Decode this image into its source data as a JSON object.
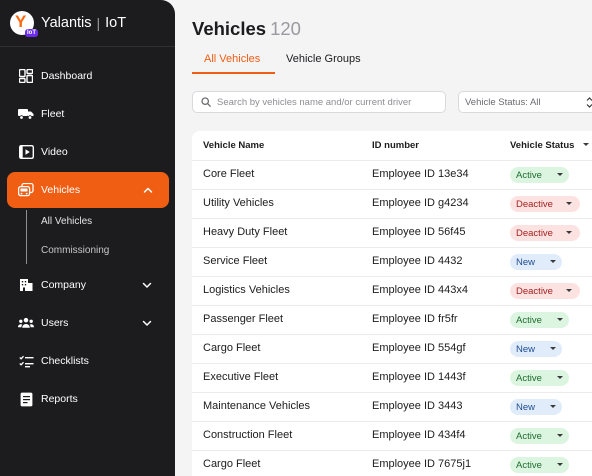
{
  "brand": {
    "name": "Yalantis",
    "separator": "|",
    "product": "IoT",
    "logo_letter": "Y",
    "logo_badge": "IoT"
  },
  "sidebar": {
    "items": [
      {
        "label": "Dashboard",
        "icon": "dashboard-icon"
      },
      {
        "label": "Fleet",
        "icon": "truck-icon"
      },
      {
        "label": "Video",
        "icon": "video-icon"
      },
      {
        "label": "Vehicles",
        "icon": "vehicles-icon",
        "active": true,
        "expanded": true
      },
      {
        "label": "Company",
        "icon": "company-icon"
      },
      {
        "label": "Users",
        "icon": "users-icon"
      },
      {
        "label": "Checklists",
        "icon": "checklist-icon"
      },
      {
        "label": "Reports",
        "icon": "reports-icon"
      }
    ],
    "vehicles_sub": [
      {
        "label": "All Vehicles"
      },
      {
        "label": "Commissioning"
      }
    ]
  },
  "page": {
    "title": "Vehicles",
    "count": "120"
  },
  "tabs": [
    {
      "label": "All Vehicles",
      "active": true
    },
    {
      "label": "Vehicle Groups",
      "active": false
    }
  ],
  "search": {
    "placeholder": "Search by vehicles name and/or current driver",
    "value": ""
  },
  "status_filter": {
    "label": "Vehicle Status: All"
  },
  "table": {
    "columns": [
      "Vehicle Name",
      "ID number",
      "Vehicle Status"
    ],
    "rows": [
      {
        "name": "Core Fleet",
        "id": "Employee ID 13e34",
        "status": "Active"
      },
      {
        "name": "Utility Vehicles",
        "id": "Employee ID g4234",
        "status": "Deactive"
      },
      {
        "name": "Heavy Duty Fleet",
        "id": "Employee ID 56f45",
        "status": "Deactive"
      },
      {
        "name": "Service Fleet",
        "id": "Employee ID 4432",
        "status": "New"
      },
      {
        "name": "Logistics Vehicles",
        "id": "Employee ID 443x4",
        "status": "Deactive"
      },
      {
        "name": "Passenger Fleet",
        "id": "Employee ID fr5fr",
        "status": "Active"
      },
      {
        "name": "Cargo Fleet",
        "id": "Employee ID 554gf",
        "status": "New"
      },
      {
        "name": "Executive Fleet",
        "id": "Employee ID 1443f",
        "status": "Active"
      },
      {
        "name": "Maintenance Vehicles",
        "id": "Employee ID 3443",
        "status": "New"
      },
      {
        "name": "Construction Fleet",
        "id": "Employee ID 434f4",
        "status": "Active"
      },
      {
        "name": "Cargo Fleet",
        "id": "Employee ID 7675j1",
        "status": "Active"
      }
    ]
  },
  "colors": {
    "accent": "#f05e14",
    "sidebar_bg": "#1c1c1e",
    "active_badge": "#dcf5e0",
    "deactive_badge": "#fde2e2",
    "new_badge": "#e1ecfb"
  }
}
